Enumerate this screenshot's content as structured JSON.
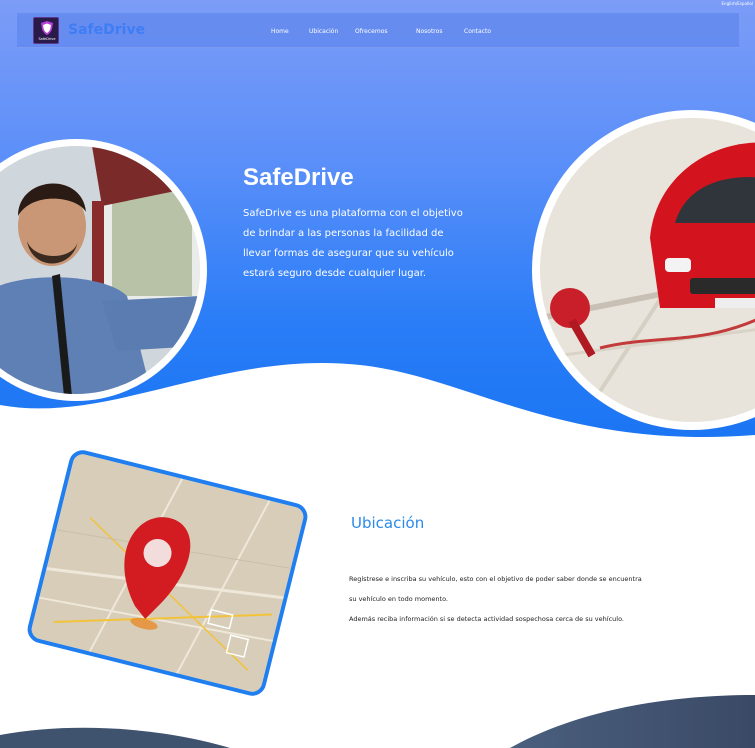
{
  "lang_switch": "English/Español",
  "header": {
    "logo_caption": "SafeDrive",
    "brand": "SafeDrive",
    "nav": [
      {
        "label": "Home"
      },
      {
        "label": "Ubicación"
      },
      {
        "label": "Ofrecemos"
      },
      {
        "label": "Nosotros"
      },
      {
        "label": "Contacto"
      }
    ]
  },
  "hero": {
    "title": "SafeDrive",
    "description": "SafeDrive es una plataforma con el objetivo de brindar a las personas la facilidad de llevar formas de asegurar que su vehículo estará seguro desde cualquier lugar."
  },
  "location": {
    "title": "Ubicación",
    "lines": [
      "Regístrese e inscriba su vehículo, esto con el objetivo de poder saber donde se encuentra",
      "su vehículo en todo momento.",
      "Además reciba información si se detecta actividad sospechosa cerca de su vehículo."
    ]
  },
  "colors": {
    "accent": "#2b8ae8",
    "hero_gradient_top": "#7c9cf7",
    "hero_gradient_bottom": "#1874f2",
    "footer": "#3a4a66"
  }
}
